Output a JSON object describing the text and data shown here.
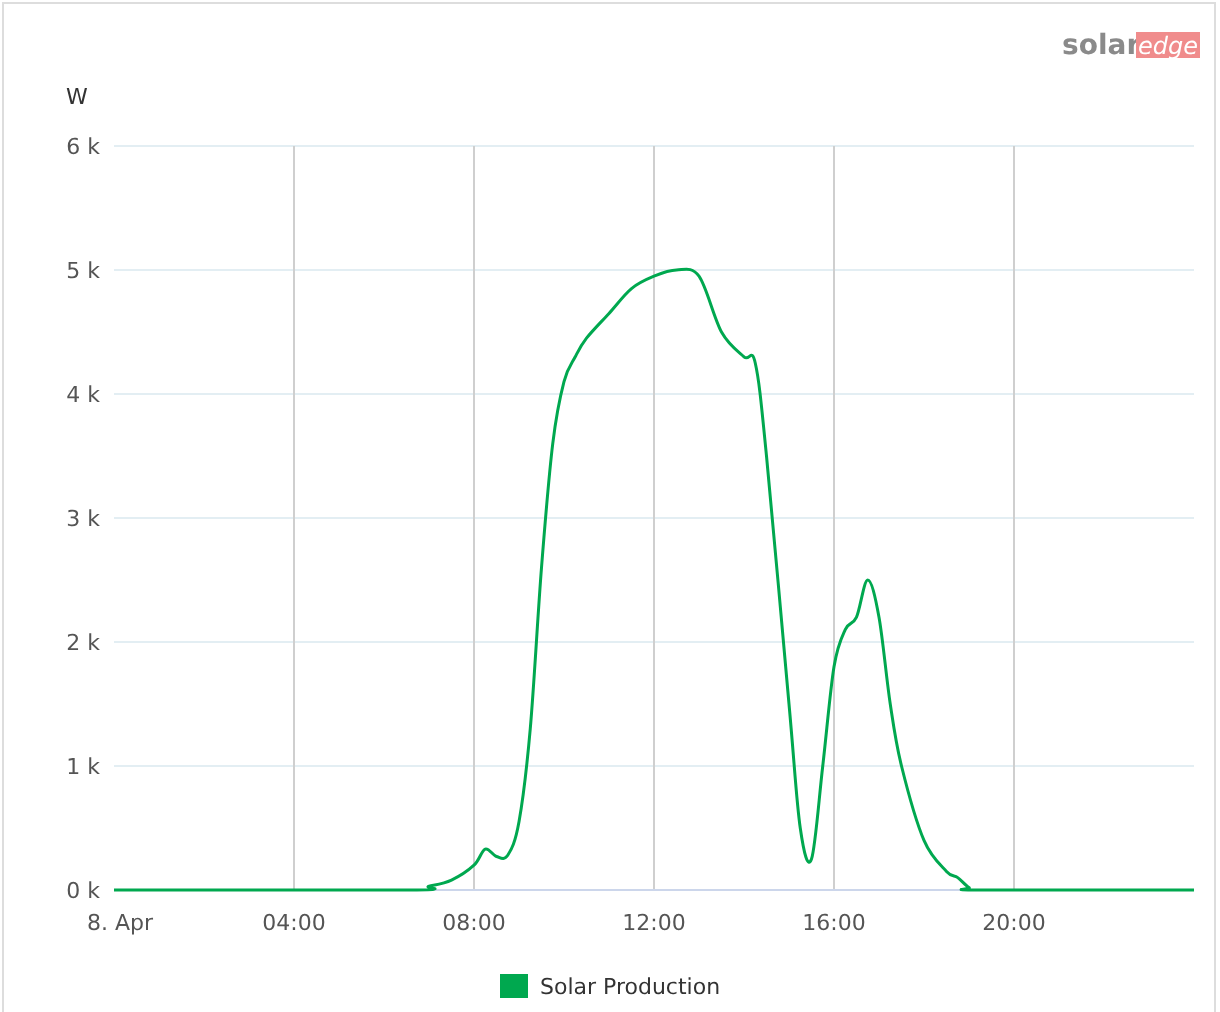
{
  "logo": {
    "part_1": "solar",
    "part_2": "edge"
  },
  "chart": {
    "chart_data": {
      "type": "line",
      "ylabel": "W",
      "x": [
        0,
        6.5,
        7,
        7.5,
        8,
        8.25,
        8.5,
        8.75,
        9,
        9.25,
        9.5,
        9.75,
        10,
        10.25,
        10.5,
        11,
        11.5,
        12,
        12.5,
        13,
        13.5,
        14,
        14.25,
        14.5,
        15,
        15.25,
        15.5,
        15.75,
        16,
        16.25,
        16.5,
        16.75,
        17,
        17.25,
        17.5,
        18,
        18.5,
        18.75,
        19,
        19.25,
        24
      ],
      "series": [
        {
          "name": "Solar Production",
          "color": "#00a84f",
          "values": [
            0,
            0,
            30,
            80,
            200,
            330,
            270,
            280,
            550,
            1300,
            2600,
            3600,
            4100,
            4300,
            4450,
            4650,
            4850,
            4950,
            5000,
            4950,
            4500,
            4300,
            4250,
            3500,
            1500,
            500,
            250,
            1000,
            1800,
            2100,
            2200,
            2500,
            2200,
            1500,
            1000,
            400,
            150,
            100,
            20,
            0,
            0
          ]
        }
      ],
      "grid": true,
      "xlim": [
        0,
        24
      ],
      "ylim": [
        0,
        6000
      ],
      "xticks": [
        {
          "value": 0,
          "label": "8. Apr"
        },
        {
          "value": 4,
          "label": "04:00"
        },
        {
          "value": 8,
          "label": "08:00"
        },
        {
          "value": 12,
          "label": "12:00"
        },
        {
          "value": 16,
          "label": "16:00"
        },
        {
          "value": 20,
          "label": "20:00"
        }
      ],
      "yticks": [
        {
          "value": 0,
          "label": "0 k"
        },
        {
          "value": 1000,
          "label": "1 k"
        },
        {
          "value": 2000,
          "label": "2 k"
        },
        {
          "value": 3000,
          "label": "3 k"
        },
        {
          "value": 4000,
          "label": "4 k"
        },
        {
          "value": 5000,
          "label": "5 k"
        },
        {
          "value": 6000,
          "label": "6 k"
        }
      ]
    }
  }
}
